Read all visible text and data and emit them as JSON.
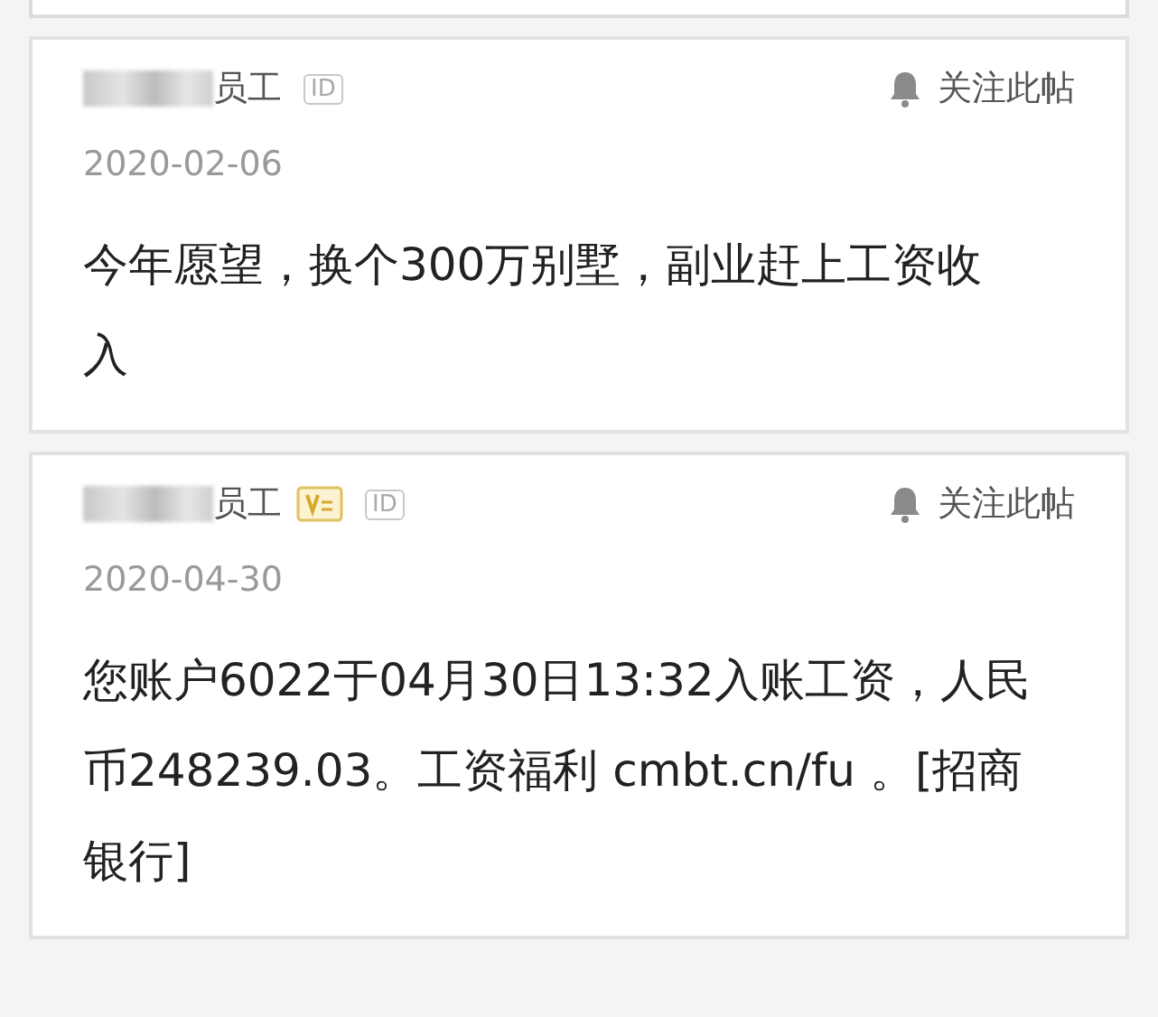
{
  "posts": [
    {
      "author": "员工",
      "vip": false,
      "id_badge": "ID",
      "follow": "关注此帖",
      "date": "2020-02-06",
      "body_lines": [
        "今年愿望，换个300万别墅，副业赶上工资收",
        "入"
      ]
    },
    {
      "author": "员工",
      "vip": true,
      "id_badge": "ID",
      "follow": "关注此帖",
      "date": "2020-04-30",
      "body_lines": [
        "您账户6022于04月30日13:32入账工资，人民",
        "币248239.03。工资福利 cmbt.cn/fu 。[招商",
        "银行]"
      ]
    }
  ]
}
